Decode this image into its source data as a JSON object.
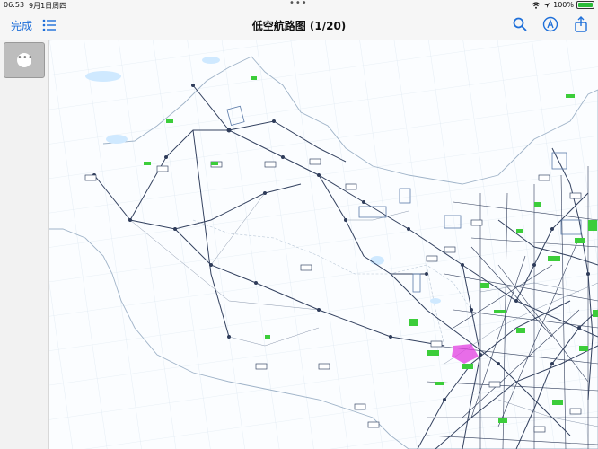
{
  "status": {
    "time": "06:53",
    "date": "9月1日周四",
    "battery": "100%"
  },
  "toolbar": {
    "done_label": "完成",
    "title": "低空航路图 (1/20)"
  },
  "sidebar": {
    "pages": [
      {
        "thumbnail": "page 1"
      }
    ]
  },
  "icons": {
    "list": "list-icon",
    "search": "search-icon",
    "markup": "markup-pen-icon",
    "share": "share-icon",
    "wifi": "wifi-icon",
    "battery": "battery-icon"
  },
  "colors": {
    "accent": "#1e6fd9",
    "route": "#33415f",
    "green_label": "#3ccd3a",
    "border": "#9fb3c8",
    "water": "#cfe9ff",
    "highlight": "#e23ce0"
  }
}
